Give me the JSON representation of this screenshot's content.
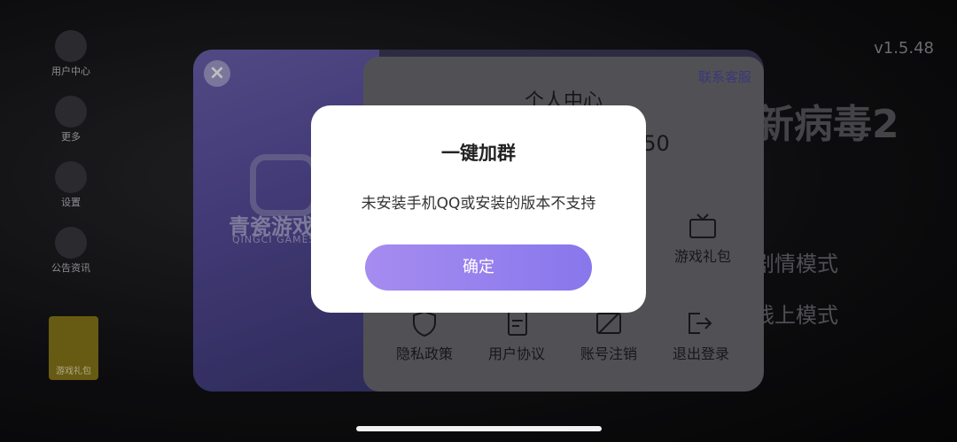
{
  "sidebar": {
    "items": [
      {
        "label": "用户中心"
      },
      {
        "label": "更多"
      },
      {
        "label": "设置"
      },
      {
        "label": "公告资讯"
      }
    ],
    "gift_tile": "游戏礼包"
  },
  "version": "v1.5.48",
  "background_game_title": "新病毒2",
  "background_modes": [
    "剧情模式",
    "线上模式"
  ],
  "panel": {
    "logo_text": "青瓷游戏",
    "logo_sub": "QINGCI GAMES",
    "contact_label": "联系客服",
    "title": "个人中心",
    "number_partial": "650",
    "grid": [
      {
        "label": "游戏礼包",
        "icon": "tv-icon"
      },
      {
        "label": "隐私政策",
        "icon": "shield-icon"
      },
      {
        "label": "用户协议",
        "icon": "document-icon"
      },
      {
        "label": "账号注销",
        "icon": "account-cancel-icon"
      },
      {
        "label": "退出登录",
        "icon": "logout-icon"
      }
    ]
  },
  "dialog": {
    "title": "一键加群",
    "message": "未安装手机QQ或安装的版本不支持",
    "confirm_label": "确定"
  }
}
